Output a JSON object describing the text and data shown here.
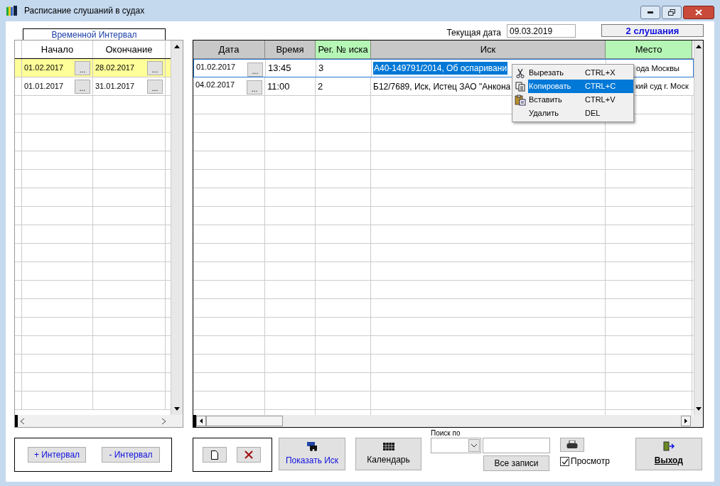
{
  "window": {
    "title": "Расписание слушаний в судах"
  },
  "interval_panel": {
    "tab": "Временной Интервал",
    "columns": [
      "Начало",
      "Окончание"
    ],
    "rows": [
      {
        "start": "01.02.2017",
        "end": "28.02.2017",
        "selected": true
      },
      {
        "start": "01.01.2017",
        "end": "31.01.2017",
        "selected": false
      }
    ],
    "button_label": "..."
  },
  "current_date": {
    "label": "Текущая дата",
    "value": "09.03.2019"
  },
  "count": "2 слушания",
  "hearings": {
    "columns": [
      {
        "label": "Дата",
        "highlight": false
      },
      {
        "label": "Время",
        "highlight": false
      },
      {
        "label": "Рег. № иска",
        "highlight": true
      },
      {
        "label": "Иск",
        "highlight": false
      },
      {
        "label": "Место",
        "highlight": true
      }
    ],
    "rows": [
      {
        "date": "01.02.2017",
        "button": "...",
        "time": "13:45",
        "reg": "3",
        "claim": "А40-149791/2014, Об оспаривани",
        "place": "ода Москвы",
        "selected": true
      },
      {
        "date": "04.02.2017",
        "button": "...",
        "time": "11:00",
        "reg": "2",
        "claim": "Б12/7689, Иск, Истец ЗАО \"Анкона",
        "place": "кий суд г. Моск",
        "selected": false
      }
    ]
  },
  "context_menu": [
    {
      "kind": "cut",
      "label": "Вырезать",
      "shortcut": "CTRL+X",
      "selected": false
    },
    {
      "kind": "copy",
      "label": "Копировать",
      "shortcut": "CTRL+C",
      "selected": true
    },
    {
      "kind": "paste",
      "label": "Вставить",
      "shortcut": "CTRL+V",
      "selected": false
    },
    {
      "kind": "none",
      "label": "Удалить",
      "shortcut": "DEL",
      "selected": false
    }
  ],
  "interval_buttons": [
    "+ Интервал",
    "- Интервал"
  ],
  "show_claim": "Показать Иск",
  "calendar": "Календарь",
  "search": {
    "label": "Поиск по",
    "all_records": "Все записи"
  },
  "preview": {
    "label": "Просмотр",
    "checked": true
  },
  "exit": "Выход"
}
